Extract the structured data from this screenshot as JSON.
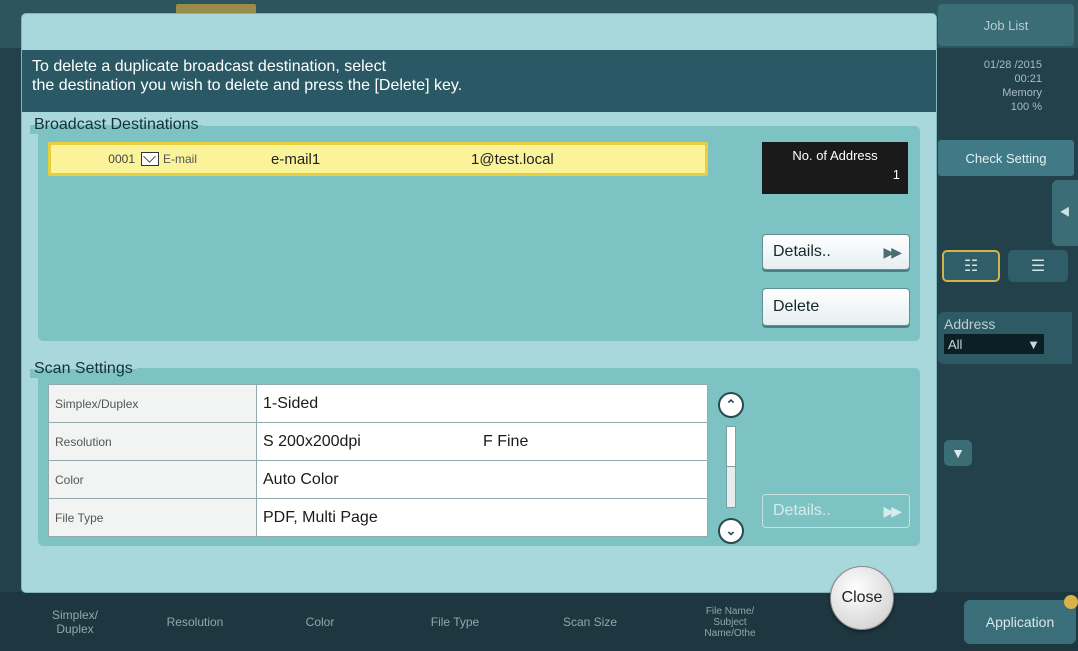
{
  "background": {
    "job_list": "Job List",
    "status_date": "01/28 /2015",
    "status_time": "00:21",
    "status_memory_label": "Memory",
    "status_memory_value": "100 %",
    "check_setting": "Check Setting",
    "address_label": "Address",
    "address_value": "All",
    "bottom_tabs": [
      "Simplex/\nDuplex",
      "Resolution",
      "Color",
      "File Type",
      "Scan Size",
      "File Name/\nSubject\nName/Othe"
    ],
    "application": "Application"
  },
  "dialog": {
    "message_line1": "To delete a duplicate broadcast destination, select",
    "message_line2": "the destination you wish to delete and press the [Delete] key.",
    "broadcast_title": "Broadcast Destinations",
    "destinations": [
      {
        "number": "0001",
        "type": "E-mail",
        "name": "e-mail1",
        "address": "1@test.local"
      }
    ],
    "address_count_label": "No. of Address",
    "address_count_value": "1",
    "details_button": "Details..",
    "delete_button": "Delete",
    "scan_title": "Scan Settings",
    "scan_settings": [
      {
        "label": "Simplex/Duplex",
        "value": "1-Sided",
        "value2": ""
      },
      {
        "label": "Resolution",
        "value": "S 200x200dpi",
        "value2": "F Fine"
      },
      {
        "label": "Color",
        "value": "Auto Color",
        "value2": ""
      },
      {
        "label": "File Type",
        "value": "PDF, Multi Page",
        "value2": ""
      }
    ],
    "scan_details_button": "Details..",
    "close_button": "Close"
  }
}
